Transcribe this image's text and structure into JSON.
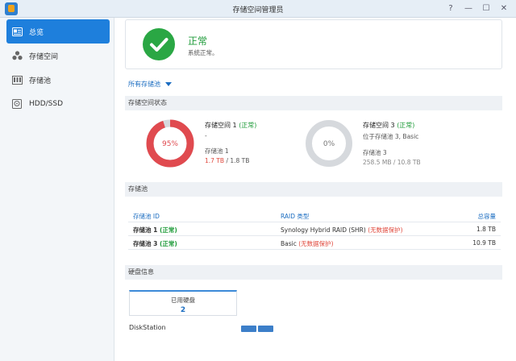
{
  "window": {
    "title": "存储空间管理员",
    "controls": [
      "?",
      "—",
      "☐",
      "✕"
    ]
  },
  "sidebar": {
    "items": [
      {
        "label": "总览",
        "icon": "overview-icon",
        "active": true
      },
      {
        "label": "存储空间",
        "icon": "storage-volumes-icon",
        "active": false
      },
      {
        "label": "存储池",
        "icon": "storage-pool-icon",
        "active": false
      },
      {
        "label": "HDD/SSD",
        "icon": "hdd-icon",
        "active": false
      }
    ]
  },
  "summary": {
    "status": "正常",
    "description": "系统正常。"
  },
  "filter": {
    "label": "所有存储池"
  },
  "volume_status": {
    "header": "存储空间状态",
    "volumes": [
      {
        "percent_label": "95%",
        "usage_fraction": 0.95,
        "name": "存储空间 1",
        "status": "(正常)",
        "location": "-",
        "pool": "存储池 1",
        "used": "1.7 TB",
        "total": "/ 1.8 TB"
      },
      {
        "percent_label": "0%",
        "usage_fraction": 0.0,
        "name": "存储空间 3",
        "status": "(正常)",
        "location": "位于存储池 3, Basic",
        "pool": "存储池 3",
        "used": "258.5 MB",
        "total": "/ 10.8 TB"
      }
    ]
  },
  "pools": {
    "header": "存储池",
    "columns": [
      "存储池 ID",
      "RAID 类型",
      "总容量"
    ],
    "rows": [
      {
        "id": "存储池 1",
        "status": "(正常)",
        "raid": "Synology Hybrid RAID (SHR)",
        "warning": "(无数据保护)",
        "capacity": "1.8 TB"
      },
      {
        "id": "存储池 3",
        "status": "(正常)",
        "raid": "Basic",
        "warning": "(无数据保护)",
        "capacity": "10.9 TB"
      }
    ]
  },
  "disk_info": {
    "header": "硬盘信息",
    "used_label": "已用硬盘",
    "used_count": "2",
    "device": "DiskStation"
  },
  "colors": {
    "accent": "#1e7fdc",
    "ok": "#1f9b3a",
    "warn": "#e0483c",
    "gauge_red": "#e04a4f",
    "gauge_grey": "#d6d9dd"
  }
}
